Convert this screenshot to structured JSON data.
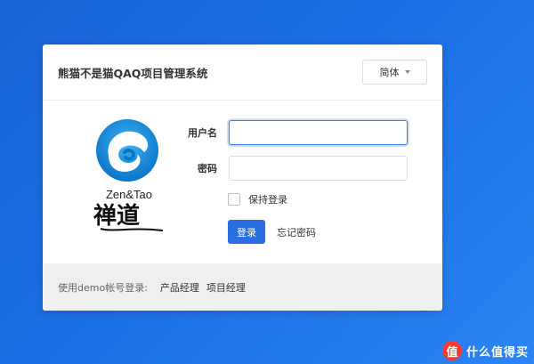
{
  "header": {
    "title": "熊猫不是猫QAQ项目管理系统",
    "language": "简体"
  },
  "logo": {
    "brand": "Zen&Tao",
    "calligraphy": "禅道"
  },
  "form": {
    "username_label": "用户名",
    "username_value": "",
    "password_label": "密码",
    "password_value": "",
    "remember_label": "保持登录",
    "remember_checked": false,
    "login_button": "登录",
    "forgot_link": "忘记密码"
  },
  "footer": {
    "demo_label": "使用demo帐号登录:",
    "accounts": [
      "产品经理",
      "项目经理"
    ]
  },
  "watermark": {
    "glyph": "值",
    "text": "什么值得买"
  },
  "colors": {
    "background": "#1b6fe6",
    "primary_button": "#2a6fe2",
    "focus_border": "#3b7ee8",
    "footer_bg": "#efefef"
  }
}
